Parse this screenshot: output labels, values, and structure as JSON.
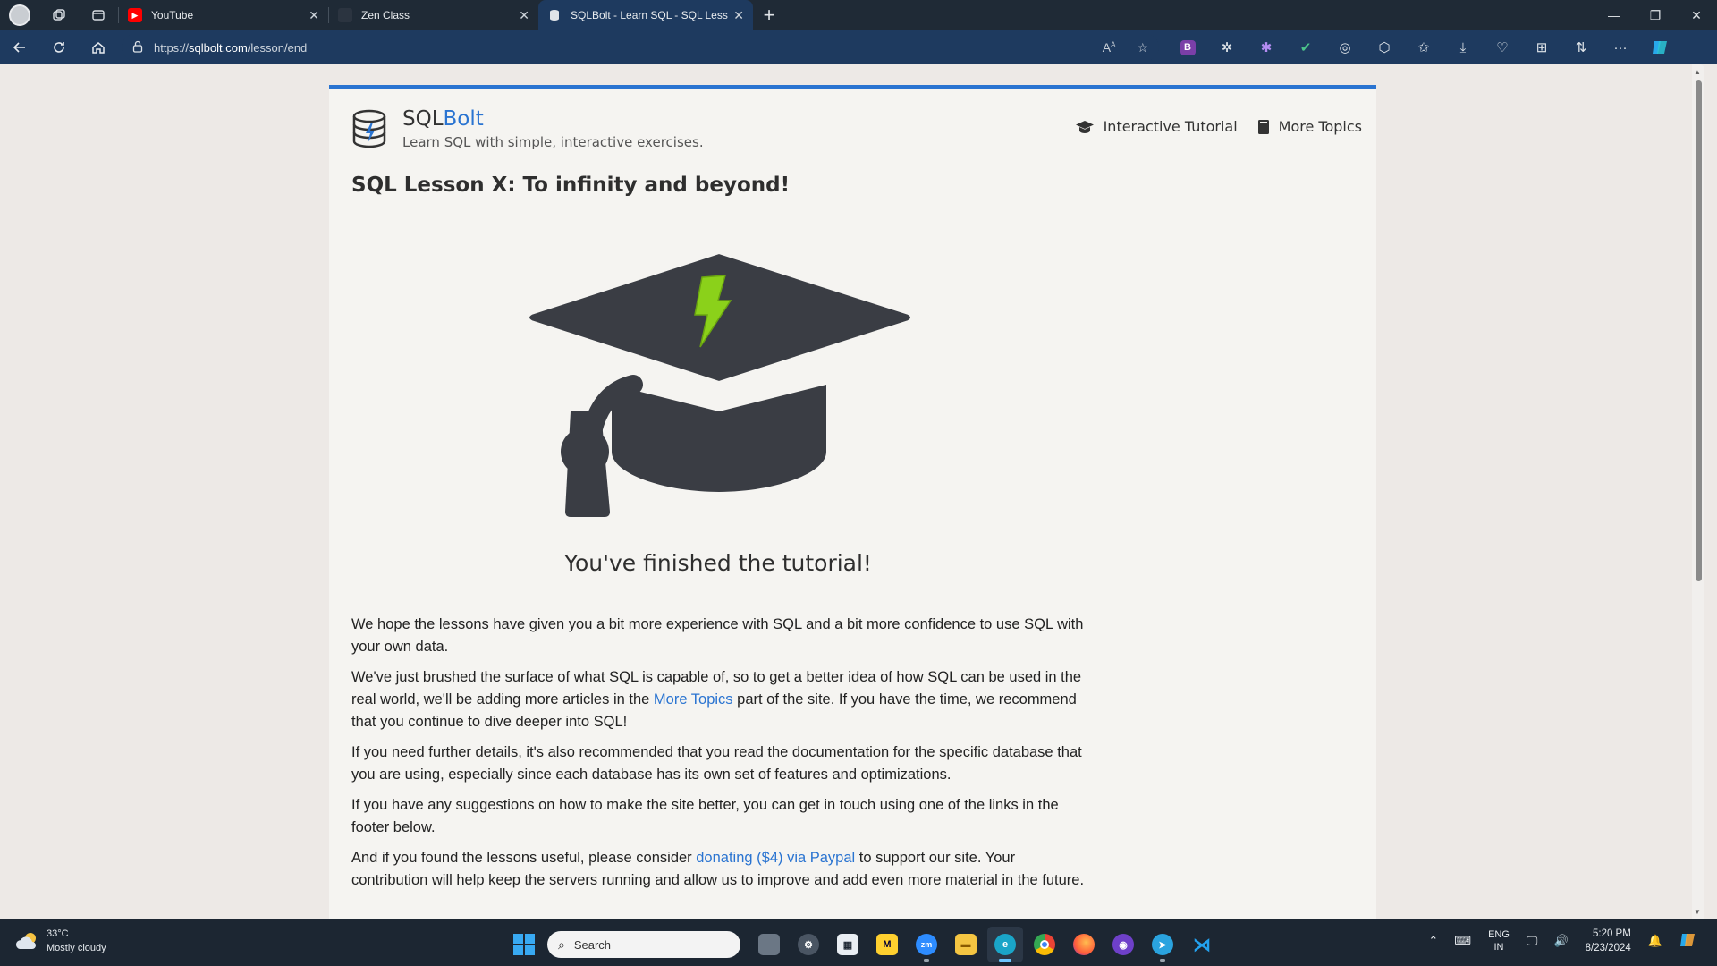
{
  "browser": {
    "tabs": [
      {
        "label": "YouTube",
        "favicon": "youtube-icon"
      },
      {
        "label": "Zen Class",
        "favicon": "zen-class-icon"
      },
      {
        "label": "SQLBolt - Learn SQL - SQL Lesson X: To infinity and beyond!",
        "favicon": "sqlbolt-icon",
        "active": true
      }
    ],
    "url_prefix": "https://",
    "url_host": "sqlbolt.com",
    "url_path": "/lesson/end"
  },
  "site": {
    "brand_sql": "SQL",
    "brand_bolt": "Bolt",
    "tagline": "Learn SQL with simple, interactive exercises.",
    "nav": [
      {
        "label": "Interactive Tutorial",
        "icon": "graduation-cap-icon"
      },
      {
        "label": "More Topics",
        "icon": "book-icon"
      }
    ],
    "accent_color": "#2a74d1"
  },
  "lesson": {
    "title": "SQL Lesson X: To infinity and beyond!",
    "finished_text": "You've finished the tutorial!",
    "p1": "We hope the lessons have given you a bit more experience with SQL and a bit more confidence to use SQL with your own data.",
    "p2_before": "We've just brushed the surface of what SQL is capable of, so to get a better idea of how SQL can be used in the real world, we'll be adding more articles in the ",
    "p2_link": "More Topics",
    "p2_after": " part of the site. If you have the time, we recommend that you continue to dive deeper into SQL!",
    "p3": "If you need further details, it's also recommended that you read the documentation for the specific database that you are using, especially since each database has its own set of features and optimizations.",
    "p4": "If you have any suggestions on how to make the site better, you can get in touch using one of the links in the footer below.",
    "p5_before": "And if you found the lessons useful, please consider ",
    "p5_link": "donating ($4) via Paypal",
    "p5_after": " to support our site. Your contribution will help keep the servers running and allow us to improve and add even more material in the future."
  },
  "taskbar": {
    "weather_temp": "33°C",
    "weather_desc": "Mostly cloudy",
    "search_placeholder": "Search",
    "lang_top": "ENG",
    "lang_bottom": "IN",
    "time": "5:20 PM",
    "date": "8/23/2024"
  }
}
